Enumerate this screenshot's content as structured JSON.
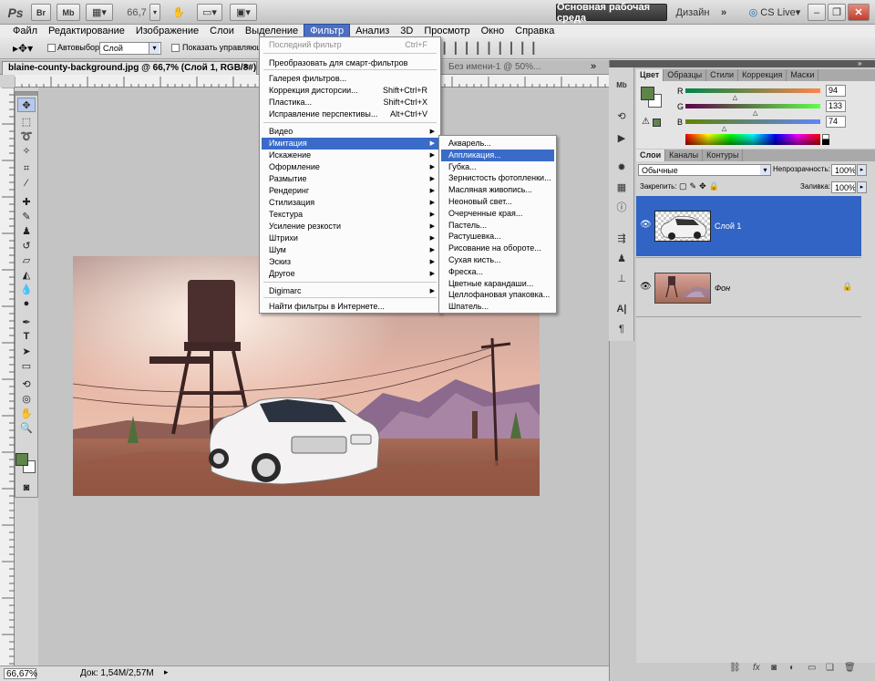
{
  "appbar": {
    "logo": "Ps",
    "bridge": "Br",
    "minibridge": "Mb",
    "zoom": "66,7",
    "workspace": "Основная рабочая среда",
    "design": "Дизайн",
    "more": "»",
    "cslive": "CS Live"
  },
  "menubar": [
    "Файл",
    "Редактирование",
    "Изображение",
    "Слои",
    "Выделение",
    "Фильтр",
    "Анализ",
    "3D",
    "Просмотр",
    "Окно",
    "Справка"
  ],
  "options": {
    "autoselect_label": "Автовыбор:",
    "autoselect_value": "Слой",
    "show_label": "Показать управляющ"
  },
  "doc_tabs": {
    "active": "blaine-county-background.jpg @ 66,7% (Слой 1, RGB/8#) *",
    "inactive": "Без имени-1 @ 50%..."
  },
  "filter_menu": {
    "items": [
      {
        "label": "Последний фильтр",
        "shortcut": "Ctrl+F",
        "disabled": true
      },
      {
        "label": "Преобразовать для смарт-фильтров"
      },
      {
        "label": "Галерея фильтров..."
      },
      {
        "label": "Коррекция дисторсии...",
        "shortcut": "Shift+Ctrl+R"
      },
      {
        "label": "Пластика...",
        "shortcut": "Shift+Ctrl+X"
      },
      {
        "label": "Исправление перспективы...",
        "shortcut": "Alt+Ctrl+V"
      },
      {
        "label": "Видео",
        "submenu": true
      },
      {
        "label": "Имитация",
        "submenu": true,
        "selected": true
      },
      {
        "label": "Искажение",
        "submenu": true
      },
      {
        "label": "Оформление",
        "submenu": true
      },
      {
        "label": "Размытие",
        "submenu": true
      },
      {
        "label": "Рендеринг",
        "submenu": true
      },
      {
        "label": "Стилизация",
        "submenu": true
      },
      {
        "label": "Текстура",
        "submenu": true
      },
      {
        "label": "Усиление резкости",
        "submenu": true
      },
      {
        "label": "Штрихи",
        "submenu": true
      },
      {
        "label": "Шум",
        "submenu": true
      },
      {
        "label": "Эскиз",
        "submenu": true
      },
      {
        "label": "Другое",
        "submenu": true
      },
      {
        "label": "Digimarc",
        "submenu": true
      },
      {
        "label": "Найти фильтры в Интернете..."
      }
    ]
  },
  "artistic_submenu": [
    "Акварель...",
    "Аппликация...",
    "Губка...",
    "Зернистость фотопленки...",
    "Масляная живопись...",
    "Неоновый свет...",
    "Очерченные края...",
    "Пастель...",
    "Растушевка...",
    "Рисование на обороте...",
    "Сухая кисть...",
    "Фреска...",
    "Цветные карандаши...",
    "Целлофановая упаковка...",
    "Шпатель..."
  ],
  "artistic_selected": 1,
  "color_panel": {
    "tabs": [
      "Цвет",
      "Образцы",
      "Стили",
      "Коррекция",
      "Маски"
    ],
    "r": "94",
    "g": "133",
    "b": "74",
    "r_frac": 0.37,
    "g_frac": 0.52,
    "b_frac": 0.29,
    "fg_color": "#5e854a"
  },
  "layers_panel": {
    "tabs": [
      "Слои",
      "Каналы",
      "Контуры"
    ],
    "blend": "Обычные",
    "opacity_label": "Непрозрачность:",
    "opacity": "100%",
    "lock_label": "Закрепить:",
    "fill_label": "Заливка:",
    "fill": "100%",
    "layers": [
      {
        "name": "Слой 1",
        "selected": true
      },
      {
        "name": "Фон",
        "italic": true
      }
    ]
  },
  "status": {
    "zoom": "66,67%",
    "doc": "Док: 1,54M/2,57M"
  },
  "colors": {
    "selection": "#3a6bc8",
    "layer_selected": "#3164c4"
  }
}
